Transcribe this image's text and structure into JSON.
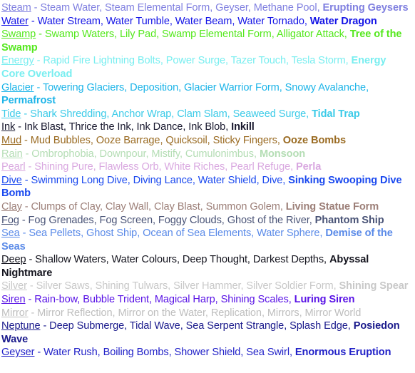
{
  "page": {
    "background": "#ffffff",
    "separator": " - ",
    "delimiter": ", "
  },
  "rows": [
    {
      "element": "Steam",
      "color": "#8080e0",
      "moves": [
        "Steam Water",
        "Steam Elemental Form",
        "Geyser",
        "Methane Pool"
      ],
      "final": "Erupting Geysers"
    },
    {
      "element": "Water",
      "color": "#1414e6",
      "moves": [
        "Water Stream",
        "Water Tumble",
        "Water Beam",
        "Water Tornado"
      ],
      "final": "Water Dragon"
    },
    {
      "element": "Swamp",
      "color": "#55e81e",
      "moves": [
        "Swamp Waters",
        "Lily Pad",
        "Swamp Elemental Form",
        "Alligator Attack"
      ],
      "final": "Tree of the Swamp"
    },
    {
      "element": "Energy",
      "color": "#79eef0",
      "moves": [
        "Rapid Fire Lightning Bolts",
        "Power Surge",
        "Tazer Touch",
        "Tesla Storm"
      ],
      "final": "Energy Core Overload"
    },
    {
      "element": "Glacier",
      "color": "#1cb4e8",
      "moves": [
        "Towering Glaciers",
        "Deposition",
        "Glacier Warrior Form",
        "Snowy Avalanche"
      ],
      "final": "Permafrost"
    },
    {
      "element": "Tide",
      "color": "#3ccbe8",
      "moves": [
        "Shark Shredding",
        "Anchor Wrap",
        "Clam Slam",
        "Seaweed Surge"
      ],
      "final": "Tidal Trap"
    },
    {
      "element": "Ink",
      "color": "#18182e",
      "moves": [
        "Ink Blast",
        "Thrice the Ink",
        "Ink Dance",
        "Ink Blob"
      ],
      "final": "Inkill"
    },
    {
      "element": "Mud",
      "color": "#9a6b22",
      "moves": [
        "Mud Bubbles",
        "Ooze Barrage",
        "Quicksoil",
        "Sticky Fingers"
      ],
      "final": "Ooze Bombs"
    },
    {
      "element": "Rain",
      "color": "#b4ddb4",
      "moves": [
        "Ombrophobia",
        "Downpour",
        "Mistify",
        "Cumulonimbus"
      ],
      "final": "Monsoon"
    },
    {
      "element": "Pearl",
      "color": "#d9a8e0",
      "moves": [
        "Shining Pure",
        "Flawless Orb",
        "White Riches",
        "Pearl Refuge"
      ],
      "final": "Perla"
    },
    {
      "element": "Dive",
      "color": "#1a49ef",
      "moves": [
        "Swimming Long Dive",
        "Diving Lance",
        "Water Shield",
        "Dive"
      ],
      "final": "Sinking Swooping Dive Bomb"
    },
    {
      "element": "Clay",
      "color": "#9c7f78",
      "moves": [
        "Clumps of Clay",
        "Clay Wall",
        "Clay Blast",
        "Summon Golem"
      ],
      "final": "Living Statue Form"
    },
    {
      "element": "Fog",
      "color": "#4a5477",
      "moves": [
        "Fog Grenades",
        "Fog Screen",
        "Foggy Clouds",
        "Ghost of the River"
      ],
      "final": "Phantom Ship"
    },
    {
      "element": "Sea",
      "color": "#5a8ae8",
      "moves": [
        "Sea Pellets",
        "Ghost Ship",
        "Ocean of Sea Elements",
        "Water Sphere"
      ],
      "final": "Demise of the Seas"
    },
    {
      "element": "Deep",
      "color": "#14141e",
      "moves": [
        "Shallow Waters",
        "Water Colours",
        "Deep Thought",
        "Darkest Depths"
      ],
      "final": "Abyssal Nightmare"
    },
    {
      "element": "Silver",
      "color": "#c8c8c8",
      "moves": [
        "Silver Saws",
        "Shining Tulwars",
        "Silver Hammer",
        "Silver Soldier Form"
      ],
      "final": "Shining Spear"
    },
    {
      "element": "Siren",
      "color": "#5a14e6",
      "moves": [
        "Rain-bow",
        "Bubble Trident",
        "Magical Harp",
        "Shining Scales"
      ],
      "final": "Luring Siren"
    },
    {
      "element": "Mirror",
      "color": "#bebebe",
      "moves": [
        "Mirror Reflection",
        "Mirror on the Water",
        "Replication",
        "Mirrors",
        "Mirror World"
      ],
      "final": ""
    },
    {
      "element": "Neptune",
      "color": "#1a1a8c",
      "moves": [
        "Deep Submerge",
        "Tidal Wave",
        "Sea Serpent Strangle",
        "Splash Edge"
      ],
      "final": "Posiedon Wave"
    },
    {
      "element": "Geyser",
      "color": "#2222c8",
      "moves": [
        "Water Rush",
        "Boiling Bombs",
        "Shower Shield",
        "Sea Swirl"
      ],
      "final": "Enormous Eruption"
    }
  ]
}
